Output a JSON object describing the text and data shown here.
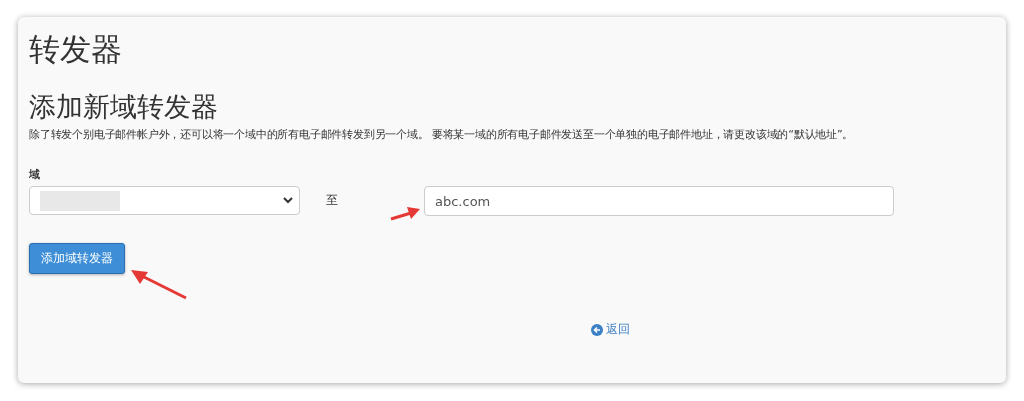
{
  "page_title": "转发器",
  "section_title": "添加新域转发器",
  "description": "除了转发个别电子邮件帐户外，还可以将一个域中的所有电子邮件转发到另一个域。 要将某一域的所有电子邮件发送至一个单独的电子邮件地址，请更改该域的“默认地址”。",
  "domain_label": "域",
  "to_label": "至",
  "target_field": {
    "value": "abc.com"
  },
  "submit_button": "添加域转发器",
  "back_link": "返回"
}
